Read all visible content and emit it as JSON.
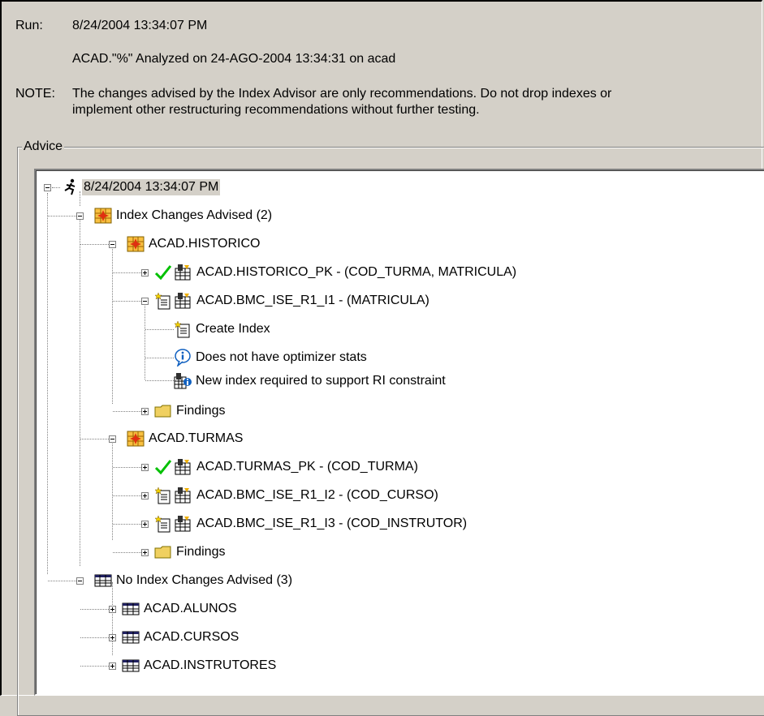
{
  "header": {
    "run_label": "Run:",
    "run_value": "8/24/2004 13:34:07 PM",
    "analyzed_text": "ACAD.\"%\" Analyzed on 24-AGO-2004 13:34:31 on acad",
    "note_label": "NOTE:",
    "note_line1": "The changes advised by the Index Advisor are only recommendations. Do not drop indexes or",
    "note_line2": "implement other restructuring recommendations without further testing."
  },
  "advice": {
    "group_label": "Advice",
    "tree": {
      "root": "8/24/2004 13:34:07 PM",
      "index_changes": "Index Changes Advised  (2)",
      "historico": "ACAD.HISTORICO",
      "historico_pk": "ACAD.HISTORICO_PK - (COD_TURMA, MATRICULA)",
      "bmc_i1": "ACAD.BMC_ISE_R1_I1 - (MATRICULA)",
      "create_index": "Create Index",
      "no_stats": "Does not have optimizer stats",
      "new_index": "New index required to support RI constraint",
      "findings_1": "Findings",
      "turmas": "ACAD.TURMAS",
      "turmas_pk": "ACAD.TURMAS_PK - (COD_TURMA)",
      "bmc_i2": "ACAD.BMC_ISE_R1_I2 - (COD_CURSO)",
      "bmc_i3": "ACAD.BMC_ISE_R1_I3 - (COD_INSTRUTOR)",
      "findings_2": "Findings",
      "no_index_changes": "No Index Changes Advised (3)",
      "alunos": "ACAD.ALUNOS",
      "cursos": "ACAD.CURSOS",
      "instrutores": "ACAD.INSTRUTORES"
    }
  },
  "colors": {
    "dialog_bg": "#d4d0c8",
    "tree_bg": "#ffffff",
    "check_green": "#00c000",
    "info_blue": "#1060c0",
    "folder_yellow": "#f0d060"
  }
}
